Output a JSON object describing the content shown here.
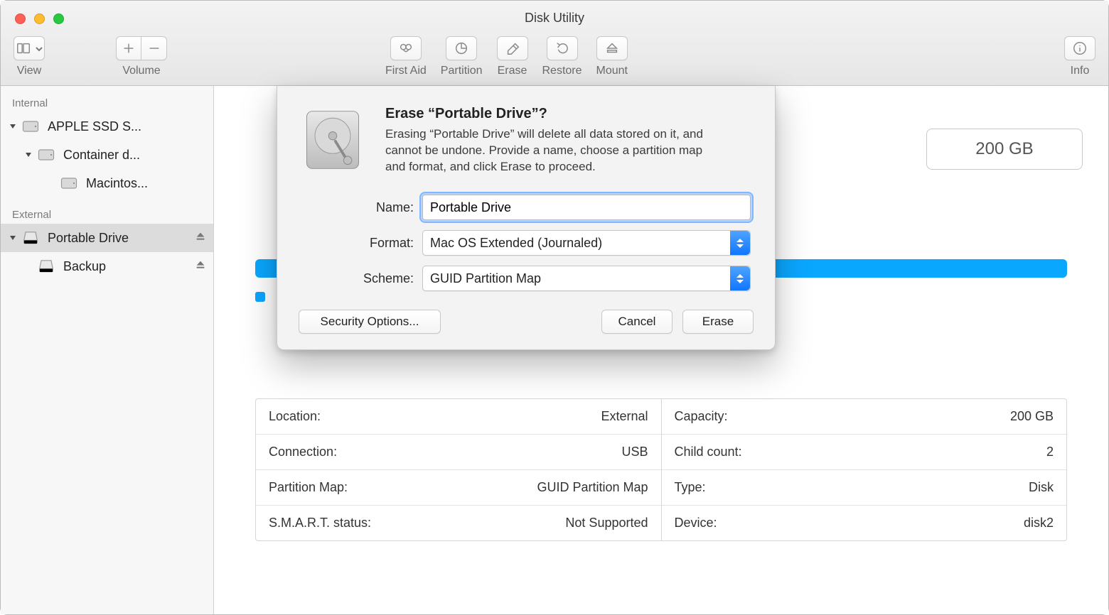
{
  "window": {
    "title": "Disk Utility"
  },
  "toolbar": {
    "view": "View",
    "volume": "Volume",
    "first_aid": "First Aid",
    "partition": "Partition",
    "erase": "Erase",
    "restore": "Restore",
    "mount": "Mount",
    "info": "Info"
  },
  "sidebar": {
    "sections": {
      "internal": "Internal",
      "external": "External"
    },
    "internal": [
      {
        "label": "APPLE SSD S..."
      },
      {
        "label": "Container d..."
      },
      {
        "label": "Macintos..."
      }
    ],
    "external": [
      {
        "label": "Portable Drive"
      },
      {
        "label": "Backup"
      }
    ]
  },
  "main": {
    "capacity": "200 GB",
    "info_left": [
      {
        "k": "Location:",
        "v": "External"
      },
      {
        "k": "Connection:",
        "v": "USB"
      },
      {
        "k": "Partition Map:",
        "v": "GUID Partition Map"
      },
      {
        "k": "S.M.A.R.T. status:",
        "v": "Not Supported"
      }
    ],
    "info_right": [
      {
        "k": "Capacity:",
        "v": "200 GB"
      },
      {
        "k": "Child count:",
        "v": "2"
      },
      {
        "k": "Type:",
        "v": "Disk"
      },
      {
        "k": "Device:",
        "v": "disk2"
      }
    ]
  },
  "sheet": {
    "title": "Erase “Portable Drive”?",
    "body": "Erasing “Portable Drive” will delete all data stored on it, and cannot be undone. Provide a name, choose a partition map and format, and click Erase to proceed.",
    "name_label": "Name:",
    "name_value": "Portable Drive",
    "format_label": "Format:",
    "format_value": "Mac OS Extended (Journaled)",
    "scheme_label": "Scheme:",
    "scheme_value": "GUID Partition Map",
    "security": "Security Options...",
    "cancel": "Cancel",
    "erase": "Erase"
  }
}
